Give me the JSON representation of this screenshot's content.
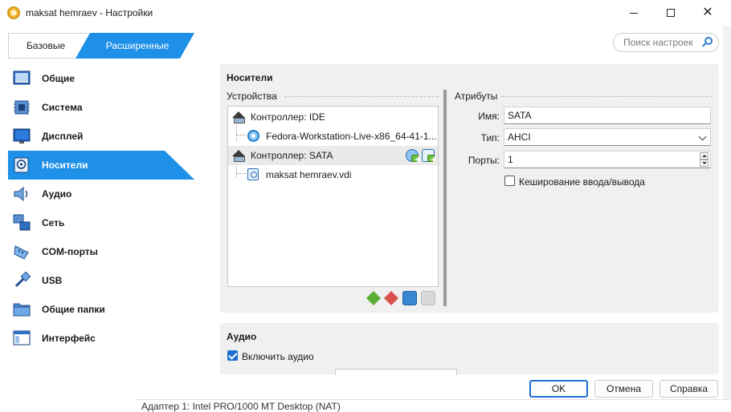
{
  "window": {
    "title": "maksat hemraev - Настройки"
  },
  "mode_tabs": {
    "basic": "Базовые",
    "expert": "Расширенные"
  },
  "search": {
    "placeholder": "Поиск настроек"
  },
  "sidebar": {
    "items": [
      {
        "label": "Общие",
        "icon": "general-icon"
      },
      {
        "label": "Система",
        "icon": "system-icon"
      },
      {
        "label": "Дисплей",
        "icon": "display-icon"
      },
      {
        "label": "Носители",
        "icon": "storage-icon",
        "active": true
      },
      {
        "label": "Аудио",
        "icon": "audio-icon"
      },
      {
        "label": "Сеть",
        "icon": "network-icon"
      },
      {
        "label": "COM-порты",
        "icon": "serial-ports-icon"
      },
      {
        "label": "USB",
        "icon": "usb-icon"
      },
      {
        "label": "Общие папки",
        "icon": "shared-folders-icon"
      },
      {
        "label": "Интерфейс",
        "icon": "user-interface-icon"
      }
    ]
  },
  "storage": {
    "title": "Носители",
    "devices_label": "Устройства",
    "attributes_label": "Атрибуты",
    "tree": [
      {
        "label": "Контроллер: IDE",
        "type": "controller"
      },
      {
        "label": "Fedora-Workstation-Live-x86_64-41-1...",
        "type": "optical"
      },
      {
        "label": "Контроллер: SATA",
        "type": "controller",
        "selected": true
      },
      {
        "label": "maksat hemraev.vdi",
        "type": "hdd"
      }
    ],
    "attributes": {
      "name_label": "Имя:",
      "name_value": "SATA",
      "type_label": "Тип:",
      "type_value": "AHCI",
      "ports_label": "Порты:",
      "ports_value": "1",
      "io_cache_label": "Кеширование ввода/вывода",
      "io_cache_checked": false
    }
  },
  "audio": {
    "title": "Аудио",
    "enable_label": "Включить аудио",
    "enable_checked": true
  },
  "buttons": {
    "ok": "OK",
    "cancel": "Отмена",
    "help": "Справка"
  },
  "background": {
    "bottom_text": "Адаптер 1:   Intel PRO/1000 MT Desktop (NAT)"
  },
  "colors": {
    "accent": "#1e90e8",
    "panel": "#f0f0f0"
  }
}
